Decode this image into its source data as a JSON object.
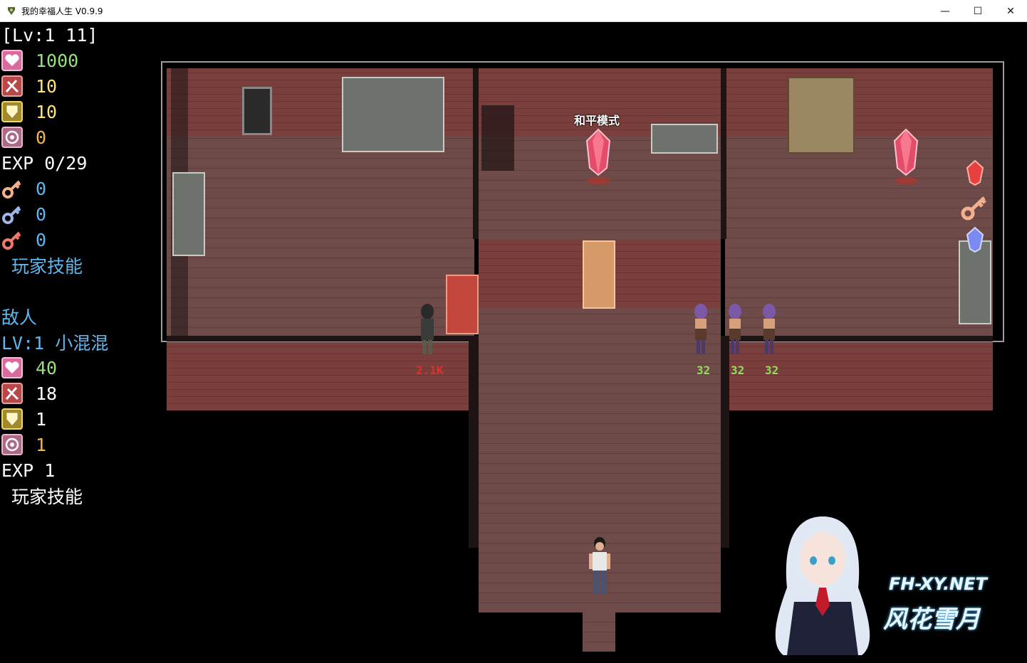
{
  "window": {
    "title": "我的幸福人生 V0.9.9",
    "controls": {
      "minimize": "—",
      "maximize": "☐",
      "close": "✕"
    }
  },
  "hud": {
    "level_line": "[Lv:1 11]",
    "player": {
      "hp": "1000",
      "attack": "10",
      "defense": "10",
      "magic": "0",
      "exp": "EXP 0/29",
      "keys": [
        "0",
        "0",
        "0"
      ],
      "skill_label": "玩家技能"
    },
    "enemy_header": "敌人",
    "enemy": {
      "name_line": "LV:1 小混混",
      "hp": "40",
      "attack": "18",
      "defense": "1",
      "magic": "1",
      "exp": "EXP  1",
      "skill_label": "玩家技能"
    },
    "icons": {
      "hp": "heart-icon",
      "attack": "sword-icon",
      "defense": "shield-icon",
      "magic": "magic-orb-icon",
      "key_colors": [
        "#f3b08e",
        "#9fb7e8",
        "#f07a6c"
      ]
    }
  },
  "map": {
    "mode_label": "和平模式",
    "enemy_damage_labels": [
      "2.1K",
      "32",
      "32",
      "32"
    ],
    "colors": {
      "danger": "#e0302a",
      "safe": "#8ee05a"
    }
  },
  "watermark": {
    "url": "FH-XY.NET",
    "name": "风花雪月"
  }
}
